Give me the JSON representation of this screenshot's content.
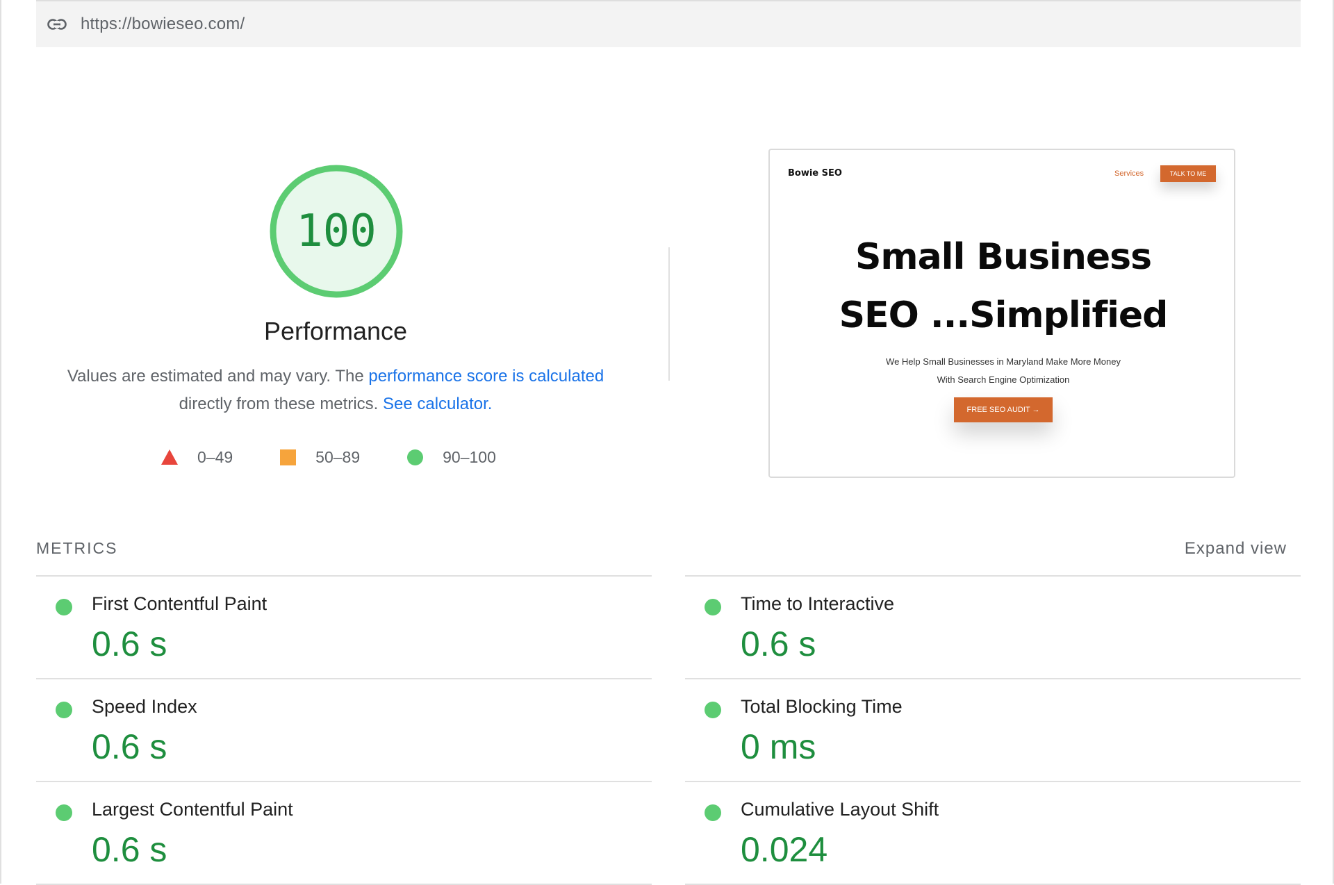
{
  "url_bar": {
    "url": "https://bowieseo.com/",
    "icon": "link-icon"
  },
  "gauge": {
    "score": "100",
    "title": "Performance",
    "color": "#5ccc72",
    "fill": "#e8f8ec",
    "text_color": "#1e8e3e"
  },
  "description": {
    "prefix": "Values are estimated and may vary. The ",
    "link1": "performance score is calculated",
    "middle": "directly from these metrics. ",
    "link2": "See calculator."
  },
  "legend": [
    {
      "shape": "triangle",
      "range": "0–49",
      "color": "#e8453c"
    },
    {
      "shape": "square",
      "range": "50–89",
      "color": "#f6a43c"
    },
    {
      "shape": "circle",
      "range": "90–100",
      "color": "#5ccc72"
    }
  ],
  "screenshot": {
    "brand": "Bowie SEO",
    "nav_link": "Services",
    "nav_button": "TALK TO ME",
    "hero_line1": "Small Business",
    "hero_line2": "SEO ...Simplified",
    "sub_line1": "We Help Small Businesses in Maryland Make More Money",
    "sub_line2": "With Search Engine Optimization",
    "cta": "FREE SEO AUDIT →",
    "accent": "#d3682e"
  },
  "metrics_header": "METRICS",
  "expand_view": "Expand view",
  "metrics_left": [
    {
      "title": "First Contentful Paint",
      "value": "0.6 s"
    },
    {
      "title": "Speed Index",
      "value": "0.6 s"
    },
    {
      "title": "Largest Contentful Paint",
      "value": "0.6 s"
    }
  ],
  "metrics_right": [
    {
      "title": "Time to Interactive",
      "value": "0.6 s"
    },
    {
      "title": "Total Blocking Time",
      "value": "0 ms"
    },
    {
      "title": "Cumulative Layout Shift",
      "value": "0.024"
    }
  ]
}
